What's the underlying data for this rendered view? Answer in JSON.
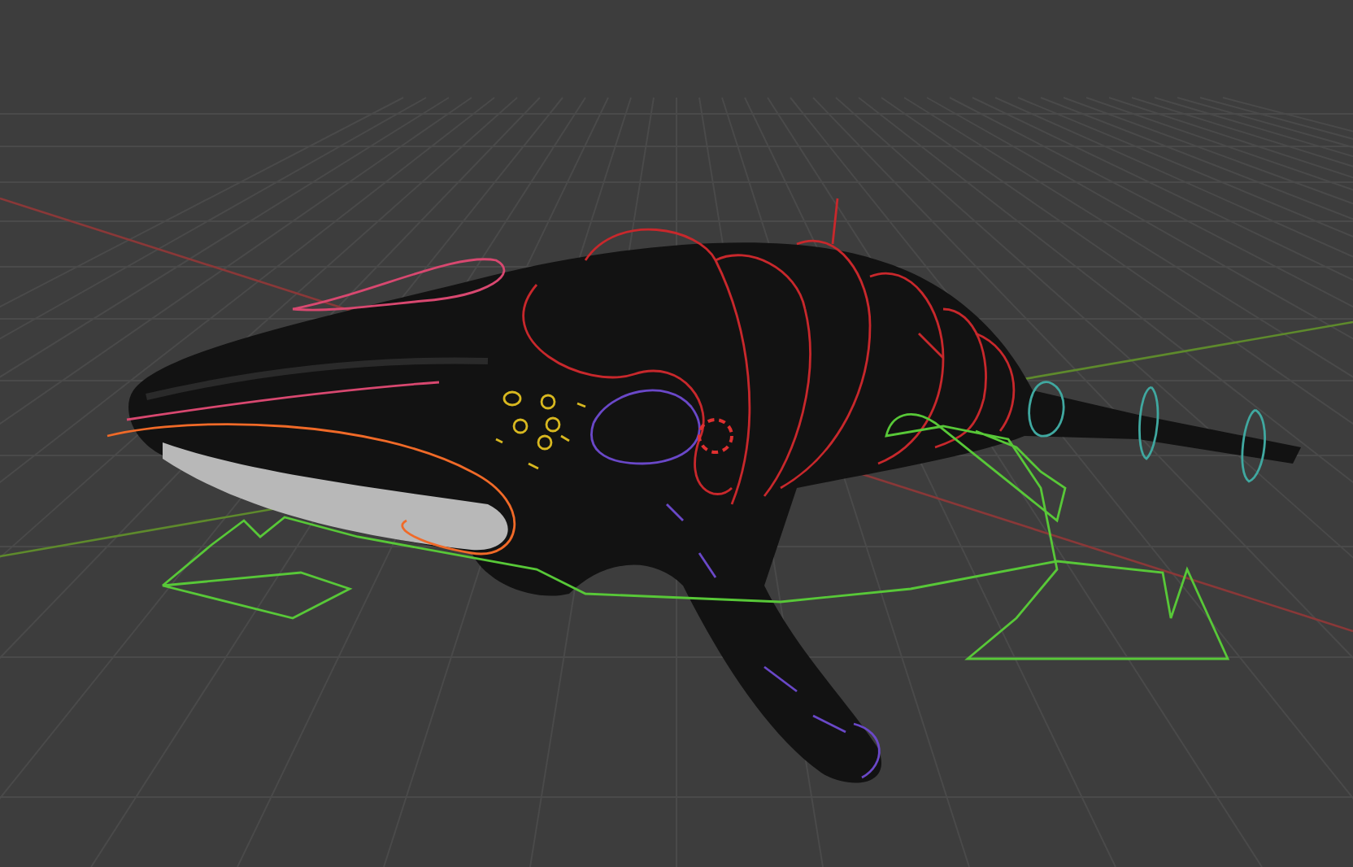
{
  "viewport": {
    "grid": true,
    "axes": true
  },
  "rig_controls": [
    {
      "kind": "rings",
      "color": "#c8282c"
    },
    {
      "kind": "jaw",
      "color": "#f06a28"
    },
    {
      "kind": "brow",
      "color": "#d84870"
    },
    {
      "kind": "shoulder",
      "color": "#6a48c8"
    },
    {
      "kind": "root",
      "color": "#58c838"
    },
    {
      "kind": "tail",
      "color": "#40a8a0"
    },
    {
      "kind": "face",
      "color": "#d8b820"
    }
  ]
}
